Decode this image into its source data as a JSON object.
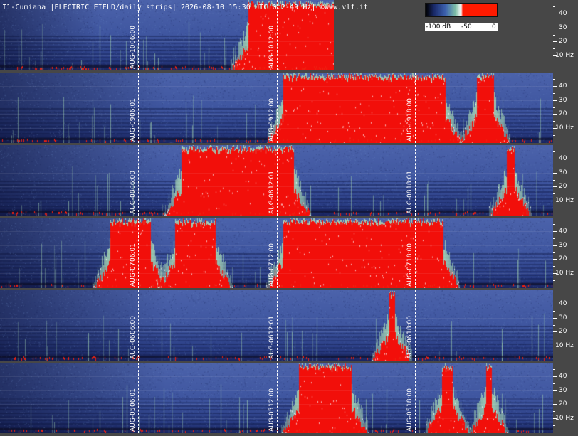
{
  "title": "I1-Cumiana |ELECTRIC FIELD/daily strips| 2026-08-10 15:30 UTC 0.2-49 Hz| ©www.vlf.it",
  "colorbar": {
    "labels": [
      "-100 dB",
      "-50",
      "0"
    ],
    "colors": [
      "#000000",
      "#1a2a6a",
      "#3d62b0",
      "#7fc0a8",
      "#ffffff",
      "#ff1a00"
    ]
  },
  "chart_data": {
    "type": "heatmap",
    "title": "I1-Cumiana |ELECTRIC FIELD/daily strips| 2026-08-10 15:30 UTC 0.2-49 Hz| ©www.vlf.it",
    "ylabel": "Hz",
    "y_ticks": [
      "40",
      "30",
      "20",
      "10 Hz"
    ],
    "y_tick_values": [
      40,
      30,
      20,
      10
    ],
    "ylim": [
      0.2,
      49
    ],
    "value_range_db": [
      -100,
      0
    ],
    "strips": [
      {
        "day": "AUG-10",
        "markers": [
          "06:00",
          "12:00"
        ],
        "data_until_hour": 14.5,
        "intense_windows_hours": [
          [
            10.8,
            14.5
          ]
        ]
      },
      {
        "day": "AUG-09",
        "markers": [
          "06:01",
          "12:00",
          "18:00"
        ],
        "data_until_hour": 24,
        "intense_windows_hours": [
          [
            12.3,
            19.3
          ],
          [
            20.7,
            21.4
          ]
        ]
      },
      {
        "day": "AUG-08",
        "markers": [
          "06:00",
          "12:01",
          "18:01"
        ],
        "data_until_hour": 24,
        "intense_windows_hours": [
          [
            7.9,
            12.7
          ],
          [
            22.0,
            22.3
          ]
        ]
      },
      {
        "day": "AUG-07",
        "markers": [
          "06:01",
          "12:00",
          "18:00"
        ],
        "data_until_hour": 24,
        "intense_windows_hours": [
          [
            4.8,
            6.5
          ],
          [
            7.6,
            9.3
          ],
          [
            12.3,
            19.2
          ]
        ]
      },
      {
        "day": "AUG-06",
        "markers": [
          "06:00",
          "12:01",
          "18:00"
        ],
        "data_until_hour": 24,
        "intense_windows_hours": [
          [
            16.9,
            17.1
          ]
        ]
      },
      {
        "day": "AUG-05",
        "markers": [
          "06:01",
          "12:00",
          "18:00"
        ],
        "data_until_hour": 24,
        "intense_windows_hours": [
          [
            13.0,
            15.2
          ],
          [
            19.2,
            19.6
          ],
          [
            21.1,
            21.3
          ]
        ]
      }
    ]
  }
}
